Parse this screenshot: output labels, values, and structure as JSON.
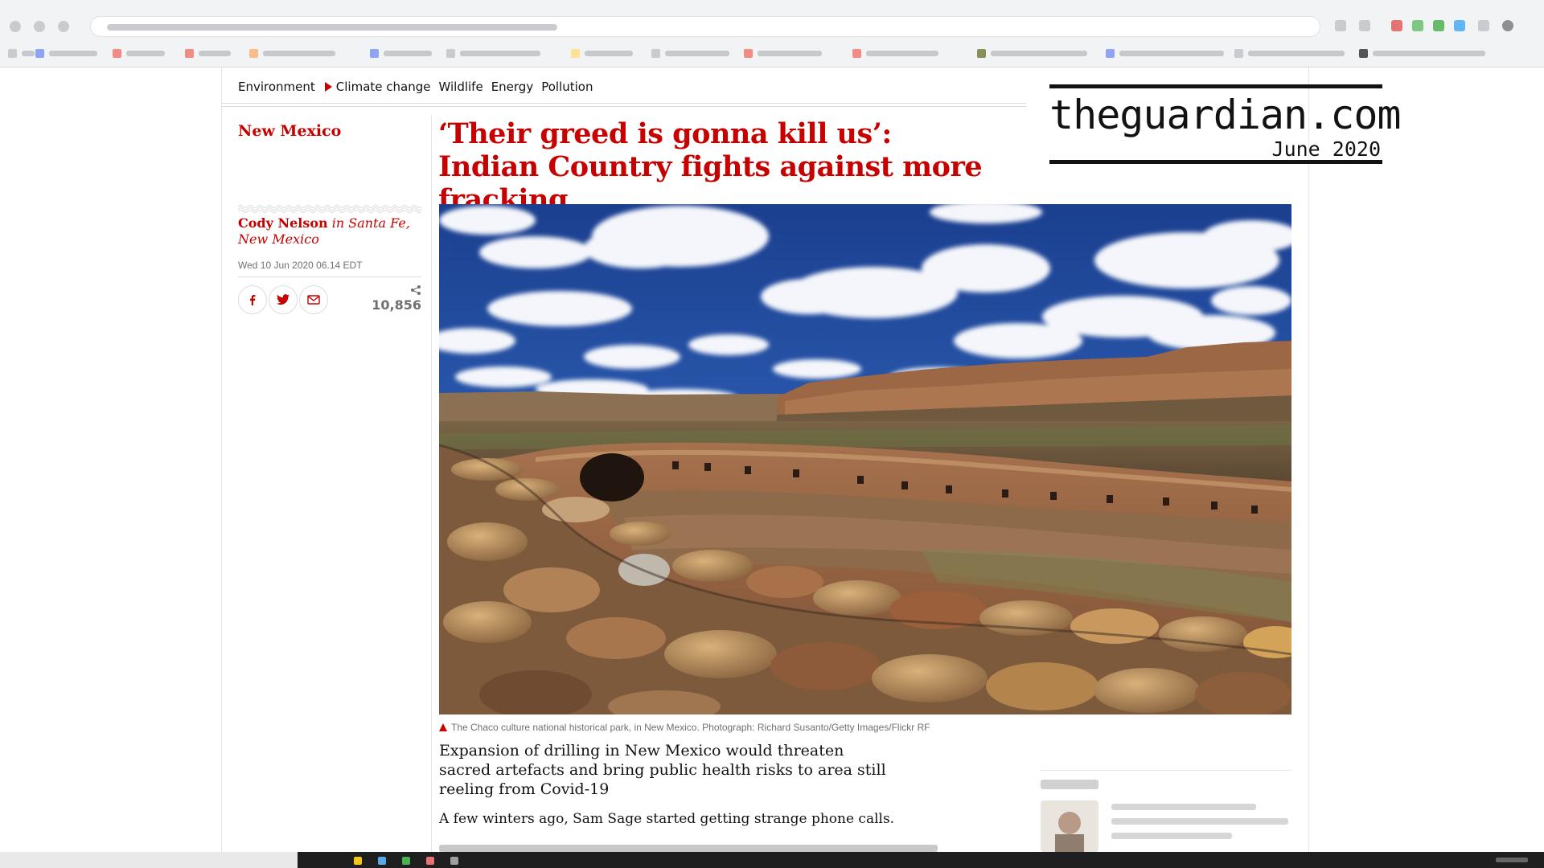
{
  "subnav": {
    "items": [
      "Environment",
      "Climate change",
      "Wildlife",
      "Energy",
      "Pollution"
    ]
  },
  "article": {
    "section": "New Mexico",
    "headline": "‘Their greed is gonna kill us’: Indian Country fights against more fracking",
    "author": "Cody Nelson",
    "location": " in Santa Fe, New Mexico",
    "date": "Wed 10 Jun 2020 06.14 EDT",
    "share_count": "10,856",
    "caption": "The Chaco culture national historical park, in New Mexico. Photograph: Richard Susanto/Getty Images/Flickr RF",
    "standfirst": "Expansion of drilling in New Mexico would threaten sacred artefacts and bring public health risks to area still reeling from Covid-19",
    "body_first": "A few winters ago, Sam Sage started getting strange phone calls."
  },
  "brand": {
    "name": "theguardian.com",
    "date": "June 2020"
  },
  "colors": {
    "accent": "#c70000",
    "text": "#121212",
    "muted": "#707070"
  },
  "icons": {
    "share": [
      "facebook-icon",
      "twitter-icon",
      "email-icon"
    ],
    "share_count": "share-icon",
    "caption": "triangle-icon"
  }
}
